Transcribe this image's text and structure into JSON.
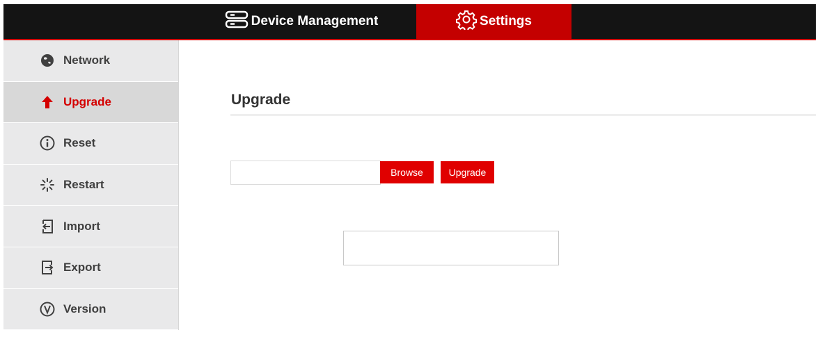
{
  "topbar": {
    "tabs": [
      {
        "label": "Device Management",
        "icon": "server-icon"
      },
      {
        "label": "Settings",
        "icon": "gear-icon",
        "active": true
      }
    ],
    "accent": "#c40000"
  },
  "sidebar": {
    "items": [
      {
        "label": "Network",
        "icon": "globe-icon"
      },
      {
        "label": "Upgrade",
        "icon": "arrow-up-icon",
        "active": true
      },
      {
        "label": "Reset",
        "icon": "info-icon"
      },
      {
        "label": "Restart",
        "icon": "spinner-icon"
      },
      {
        "label": "Import",
        "icon": "import-icon"
      },
      {
        "label": "Export",
        "icon": "export-icon"
      },
      {
        "label": "Version",
        "icon": "version-icon"
      }
    ]
  },
  "main": {
    "title": "Upgrade",
    "file_input": {
      "value": "",
      "placeholder": ""
    },
    "browse_label": "Browse",
    "upgrade_label": "Upgrade",
    "status_text": ""
  },
  "colors": {
    "topbar_bg": "#141414",
    "button_red": "#e00000",
    "active_text": "#d40000",
    "sidebar_bg": "#e9e9ea"
  }
}
